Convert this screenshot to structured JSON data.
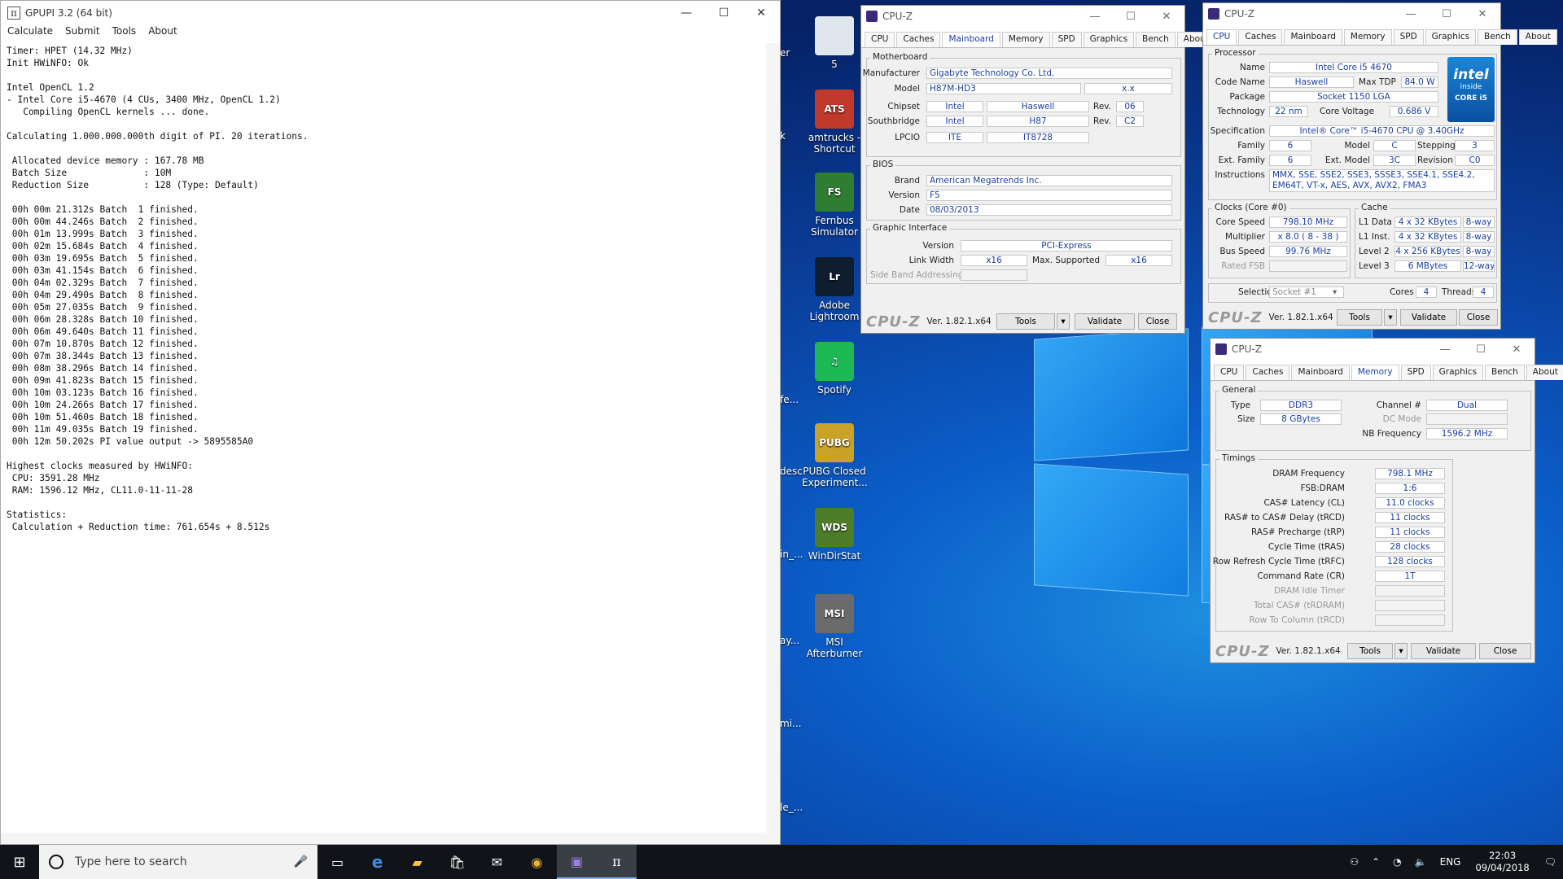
{
  "gpupi": {
    "title": "GPUPI 3.2 (64 bit)",
    "menu": [
      "Calculate",
      "Submit",
      "Tools",
      "About"
    ],
    "output": "Timer: HPET (14.32 MHz)\nInit HWiNFO: Ok\n\nIntel OpenCL 1.2\n- Intel Core i5-4670 (4 CUs, 3400 MHz, OpenCL 1.2)\n   Compiling OpenCL kernels ... done.\n\nCalculating 1.000.000.000th digit of PI. 20 iterations.\n\n Allocated device memory : 167.78 MB\n Batch Size              : 10M\n Reduction Size          : 128 (Type: Default)\n\n 00h 00m 21.312s Batch  1 finished.\n 00h 00m 44.246s Batch  2 finished.\n 00h 01m 13.999s Batch  3 finished.\n 00h 02m 15.684s Batch  4 finished.\n 00h 03m 19.695s Batch  5 finished.\n 00h 03m 41.154s Batch  6 finished.\n 00h 04m 02.329s Batch  7 finished.\n 00h 04m 29.490s Batch  8 finished.\n 00h 05m 27.035s Batch  9 finished.\n 00h 06m 28.328s Batch 10 finished.\n 00h 06m 49.640s Batch 11 finished.\n 00h 07m 10.870s Batch 12 finished.\n 00h 07m 38.344s Batch 13 finished.\n 00h 08m 38.296s Batch 14 finished.\n 00h 09m 41.823s Batch 15 finished.\n 00h 10m 03.123s Batch 16 finished.\n 00h 10m 24.266s Batch 17 finished.\n 00h 10m 51.460s Batch 18 finished.\n 00h 11m 49.035s Batch 19 finished.\n 00h 12m 50.202s PI value output -> 5895585A0\n\nHighest clocks measured by HWiNFO:\n CPU: 3591.28 MHz\n RAM: 1596.12 MHz, CL11.0-11-11-28\n\nStatistics:\n Calculation + Reduction time: 761.654s + 8.512s"
  },
  "desktop": {
    "icons": [
      {
        "label": "5",
        "abbr": "",
        "color": "#dfe6ee"
      },
      {
        "label": "amtrucks - Shortcut",
        "abbr": "ATS",
        "color": "#c0392b"
      },
      {
        "label": "Fernbus Simulator",
        "abbr": "FS",
        "color": "#2e7d32"
      },
      {
        "label": "Adobe Lightroom",
        "abbr": "Lr",
        "color": "#0f1d2e"
      },
      {
        "label": "Spotify",
        "abbr": "♫",
        "color": "#1db954"
      },
      {
        "label": "PUBG Closed Experiment...",
        "abbr": "PUBG",
        "color": "#c9a227"
      },
      {
        "label": "WinDirStat",
        "abbr": "WDS",
        "color": "#4e7d2a"
      },
      {
        "label": "MSI Afterburner",
        "abbr": "MSI",
        "color": "#6b6b6b"
      }
    ],
    "edge_fragments": [
      "er",
      "k",
      "fe...",
      "desc",
      "in_...",
      "ay...",
      "mi...",
      "le_..."
    ]
  },
  "cpuz_common": {
    "title": "CPU-Z",
    "logo": "CPU-Z",
    "version": "Ver. 1.82.1.x64",
    "tools": "Tools",
    "validate": "Validate",
    "close": "Close",
    "tabs": [
      "CPU",
      "Caches",
      "Mainboard",
      "Memory",
      "SPD",
      "Graphics",
      "Bench",
      "About"
    ]
  },
  "mainboard": {
    "active_tab": "Mainboard",
    "g_motherboard": "Motherboard",
    "manufacturer_l": "Manufacturer",
    "manufacturer": "Gigabyte Technology Co. Ltd.",
    "model_l": "Model",
    "model": "H87M-HD3",
    "model_rev": "x.x",
    "chipset_l": "Chipset",
    "chipset_v": "Intel",
    "chipset_n": "Haswell",
    "rev_l": "Rev.",
    "chipset_rev": "06",
    "south_l": "Southbridge",
    "south_v": "Intel",
    "south_n": "H87",
    "south_rev": "C2",
    "lpcio_l": "LPCIO",
    "lpcio_v": "ITE",
    "lpcio_n": "IT8728",
    "g_bios": "BIOS",
    "brand_l": "Brand",
    "brand": "American Megatrends Inc.",
    "version_l": "Version",
    "version": "F5",
    "date_l": "Date",
    "date": "08/03/2013",
    "g_graphic": "Graphic Interface",
    "gi_version_l": "Version",
    "gi_version": "PCI-Express",
    "link_l": "Link Width",
    "link": "x16",
    "maxsup_l": "Max. Supported",
    "maxsup": "x16",
    "sideband_l": "Side Band Addressing"
  },
  "cpu": {
    "active_tab": "CPU",
    "g_processor": "Processor",
    "name_l": "Name",
    "name": "Intel Core i5 4670",
    "code_l": "Code Name",
    "code": "Haswell",
    "tdp_l": "Max TDP",
    "tdp": "84.0 W",
    "package_l": "Package",
    "package": "Socket 1150 LGA",
    "tech_l": "Technology",
    "tech": "22 nm",
    "volt_l": "Core Voltage",
    "volt": "0.686 V",
    "spec_l": "Specification",
    "spec": "Intel® Core™ i5-4670 CPU @ 3.40GHz",
    "family_l": "Family",
    "family": "6",
    "model_l": "Model",
    "model": "C",
    "stepping_l": "Stepping",
    "stepping": "3",
    "extfam_l": "Ext. Family",
    "extfam": "6",
    "extmod_l": "Ext. Model",
    "extmod": "3C",
    "revision_l": "Revision",
    "revision": "C0",
    "instr_l": "Instructions",
    "instr": "MMX, SSE, SSE2, SSE3, SSSE3, SSE4.1, SSE4.2, EM64T, VT-x, AES, AVX, AVX2, FMA3",
    "intel_l1": "intel",
    "intel_l2": "inside",
    "intel_l3": "CORE i5",
    "g_clocks": "Clocks (Core #0)",
    "cspeed_l": "Core Speed",
    "cspeed": "798.10 MHz",
    "mult_l": "Multiplier",
    "mult": "x 8.0 ( 8 - 38 )",
    "bus_l": "Bus Speed",
    "bus": "99.76 MHz",
    "fsb_l": "Rated FSB",
    "g_cache": "Cache",
    "l1d_l": "L1 Data",
    "l1d": "4 x 32 KBytes",
    "l1d_w": "8-way",
    "l1i_l": "L1 Inst.",
    "l1i": "4 x 32 KBytes",
    "l1i_w": "8-way",
    "l2_l": "Level 2",
    "l2": "4 x 256 KBytes",
    "l2_w": "8-way",
    "l3_l": "Level 3",
    "l3": "6 MBytes",
    "l3_w": "12-way",
    "sel_l": "Selection",
    "sel": "Socket #1",
    "cores_l": "Cores",
    "cores": "4",
    "threads_l": "Threads",
    "threads": "4"
  },
  "memory": {
    "active_tab": "Memory",
    "g_general": "General",
    "type_l": "Type",
    "type": "DDR3",
    "size_l": "Size",
    "size": "8 GBytes",
    "channel_l": "Channel #",
    "channel": "Dual",
    "dcmode_l": "DC Mode",
    "nbf_l": "NB Frequency",
    "nbf": "1596.2 MHz",
    "g_timings": "Timings",
    "timings": [
      {
        "l": "DRAM Frequency",
        "v": "798.1 MHz"
      },
      {
        "l": "FSB:DRAM",
        "v": "1:6"
      },
      {
        "l": "CAS# Latency (CL)",
        "v": "11.0 clocks"
      },
      {
        "l": "RAS# to CAS# Delay (tRCD)",
        "v": "11 clocks"
      },
      {
        "l": "RAS# Precharge (tRP)",
        "v": "11 clocks"
      },
      {
        "l": "Cycle Time (tRAS)",
        "v": "28 clocks"
      },
      {
        "l": "Row Refresh Cycle Time (tRFC)",
        "v": "128 clocks"
      },
      {
        "l": "Command Rate (CR)",
        "v": "1T"
      },
      {
        "l": "DRAM Idle Timer",
        "v": ""
      },
      {
        "l": "Total CAS# (tRDRAM)",
        "v": ""
      },
      {
        "l": "Row To Column (tRCD)",
        "v": ""
      }
    ]
  },
  "taskbar": {
    "search_placeholder": "Type here to search",
    "lang": "ENG",
    "time": "22:03",
    "date": "09/04/2018"
  }
}
